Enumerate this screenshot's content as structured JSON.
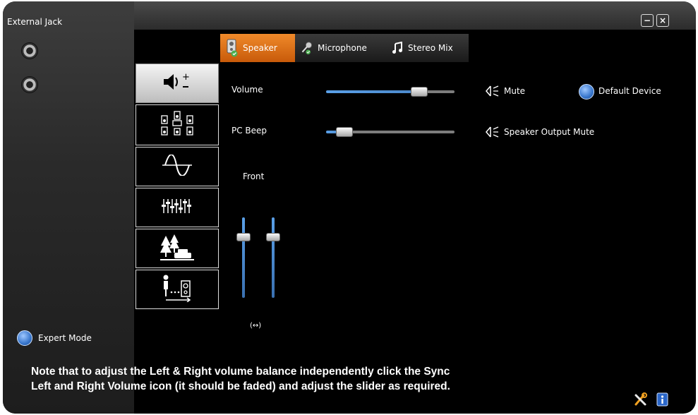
{
  "window": {
    "external_jack_label": "External Jack",
    "minimize_symbol": "−",
    "close_symbol": "×"
  },
  "tabs": [
    {
      "label": "Speaker",
      "icon": "speaker-icon",
      "active": true
    },
    {
      "label": "Microphone",
      "icon": "microphone-icon",
      "active": false
    },
    {
      "label": "Stereo Mix",
      "icon": "music-note-icon",
      "active": false
    }
  ],
  "sidebar": {
    "items": [
      {
        "name": "volume-settings",
        "icon": "volume-plus-minus-icon",
        "active": true
      },
      {
        "name": "speaker-configuration",
        "icon": "speaker-config-icon",
        "active": false
      },
      {
        "name": "sound-effects",
        "icon": "waveform-icon",
        "active": false
      },
      {
        "name": "equalizer",
        "icon": "equalizer-icon",
        "active": false
      },
      {
        "name": "environment",
        "icon": "environment-icon",
        "active": false
      },
      {
        "name": "room-correction",
        "icon": "room-correction-icon",
        "active": false
      }
    ]
  },
  "main": {
    "volume_label": "Volume",
    "volume_level": 0.75,
    "pcbeep_label": "PC Beep",
    "pcbeep_level": 0.15,
    "mute_label": "Mute",
    "speaker_output_mute_label": "Speaker Output Mute",
    "default_device_label": "Default Device",
    "front_label": "Front",
    "front_left_level": 0.85,
    "front_right_level": 0.85,
    "sync_icon_text": "(↔)"
  },
  "expert_mode_label": "Expert Mode",
  "note": {
    "line1": "Note that to adjust the Left & Right volume balance independently click the Sync",
    "line2": "Left and Right Volume icon (it should be faded) and adjust the slider as required."
  },
  "colors": {
    "accent_orange": "#e8741a",
    "slider_blue": "#5aa0e8",
    "radio_blue": "#3876cc"
  }
}
